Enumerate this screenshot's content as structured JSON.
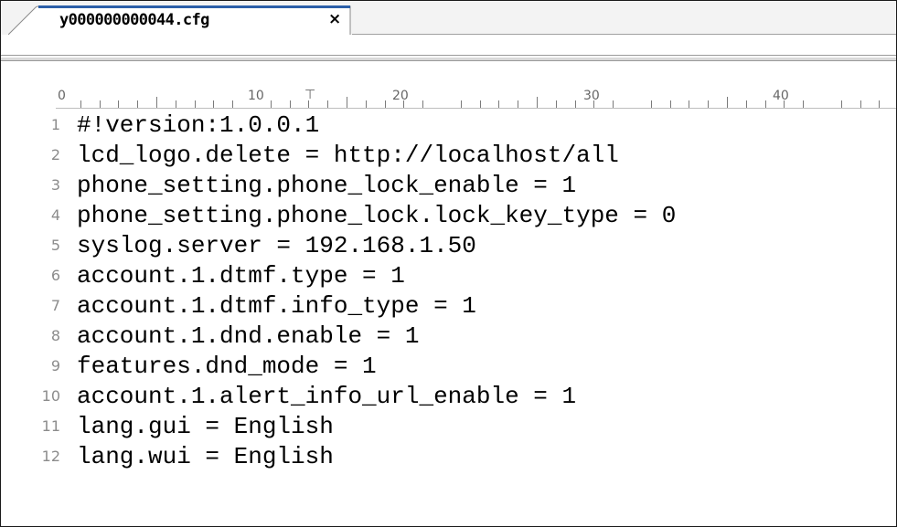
{
  "tab": {
    "filename": "y000000000044.cfg",
    "close_glyph": "×"
  },
  "ruler": {
    "labels": [
      "0",
      "10",
      "20",
      "30",
      "40"
    ]
  },
  "editor": {
    "lines": [
      {
        "num": "1",
        "text": "#!version:1.0.0.1"
      },
      {
        "num": "2",
        "text": "lcd_logo.delete = http://localhost/all"
      },
      {
        "num": "3",
        "text": "phone_setting.phone_lock_enable = 1"
      },
      {
        "num": "4",
        "text": "phone_setting.phone_lock.lock_key_type = 0"
      },
      {
        "num": "5",
        "text": "syslog.server = 192.168.1.50"
      },
      {
        "num": "6",
        "text": "account.1.dtmf.type = 1"
      },
      {
        "num": "7",
        "text": "account.1.dtmf.info_type = 1"
      },
      {
        "num": "8",
        "text": "account.1.dnd.enable = 1"
      },
      {
        "num": "9",
        "text": "features.dnd_mode = 1"
      },
      {
        "num": "10",
        "text": "account.1.alert_info_url_enable = 1"
      },
      {
        "num": "11",
        "text": "lang.gui = English"
      },
      {
        "num": "12",
        "text": "lang.wui = English"
      }
    ]
  }
}
